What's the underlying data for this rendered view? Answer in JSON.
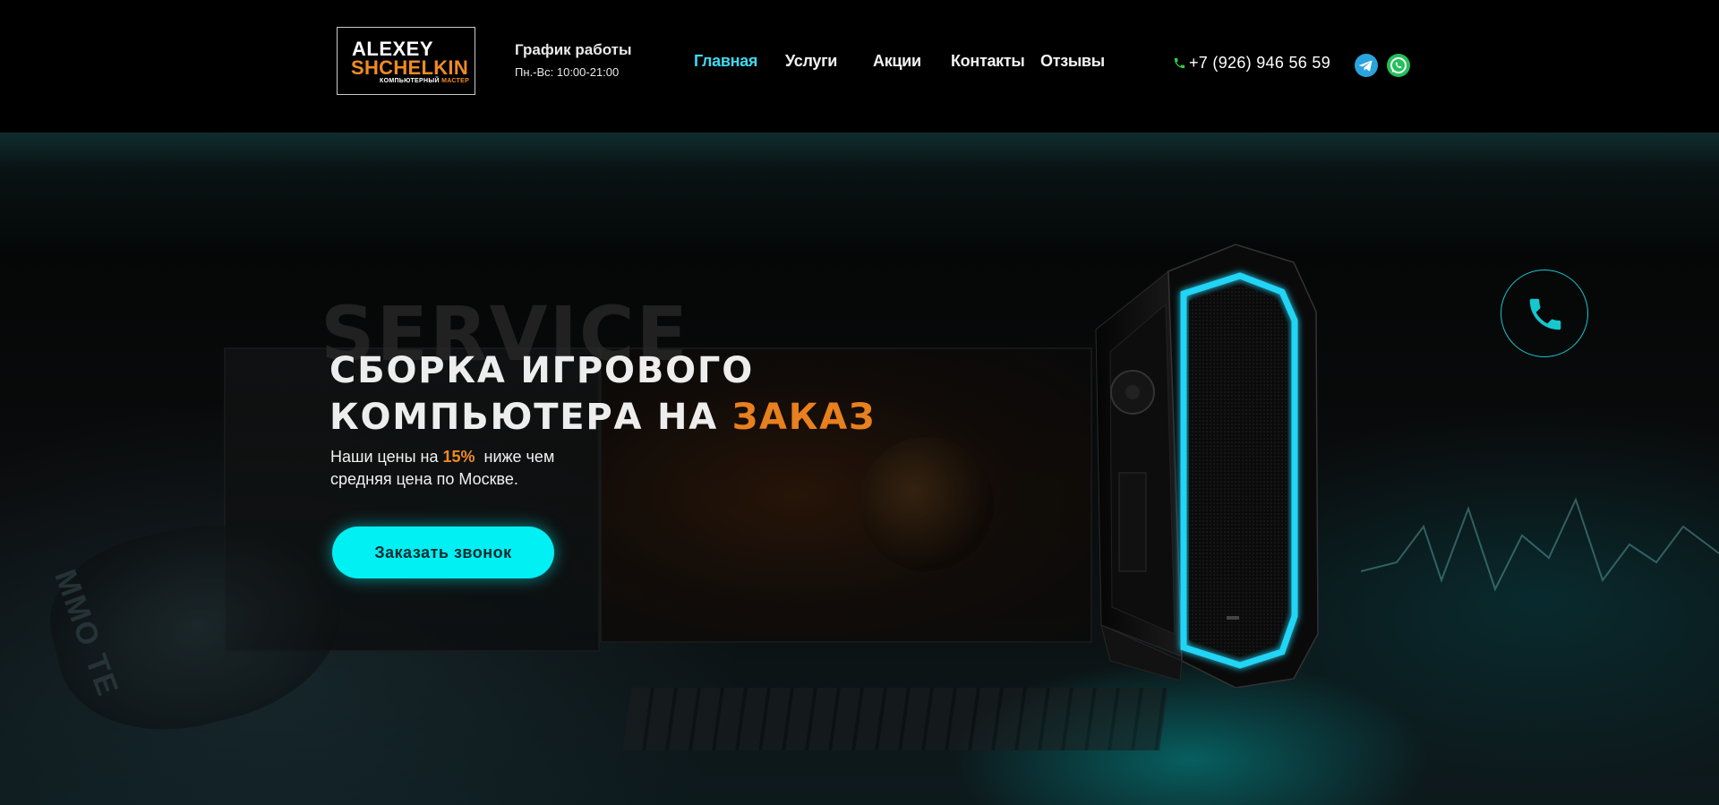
{
  "logo": {
    "line1": "ALEXEY",
    "line2": "SHCHELKIN",
    "line3_white": "КОМПЬЮТЕРНЫЙ",
    "line3_orange": "МАСТЕР"
  },
  "schedule": {
    "title": "График работы",
    "hours": "Пн.-Вс: 10:00-21:00"
  },
  "nav": {
    "items": [
      {
        "label": "Главная",
        "active": true
      },
      {
        "label": "Услуги",
        "active": false
      },
      {
        "label": "Акции",
        "active": false
      },
      {
        "label": "Контакты",
        "active": false
      },
      {
        "label": "Отзывы",
        "active": false
      }
    ]
  },
  "contact": {
    "phone": "+7 (926) 946 56 59",
    "icons": [
      "phone-icon",
      "telegram-icon",
      "whatsapp-icon"
    ]
  },
  "hero": {
    "background_word": "SERVICE",
    "headline_line1": "СБОРКА ИГРОВОГО",
    "headline_line2_prefix": "КОМПЬЮТЕРА НА ",
    "headline_line2_accent": "ЗАКАЗ",
    "sub_prefix": "Наши цены на ",
    "sub_percent": "15%",
    "sub_suffix": "  ниже чем",
    "sub_line2": "средняя цена по Москве.",
    "cta_label": "Заказать звонок",
    "bg_brand_text": "MMO TE"
  },
  "colors": {
    "accent_cyan": "#00f0f4",
    "accent_orange": "#e8801f",
    "nav_active": "#3fd9f0",
    "telegram": "#2aa3df",
    "whatsapp": "#24c05a"
  }
}
